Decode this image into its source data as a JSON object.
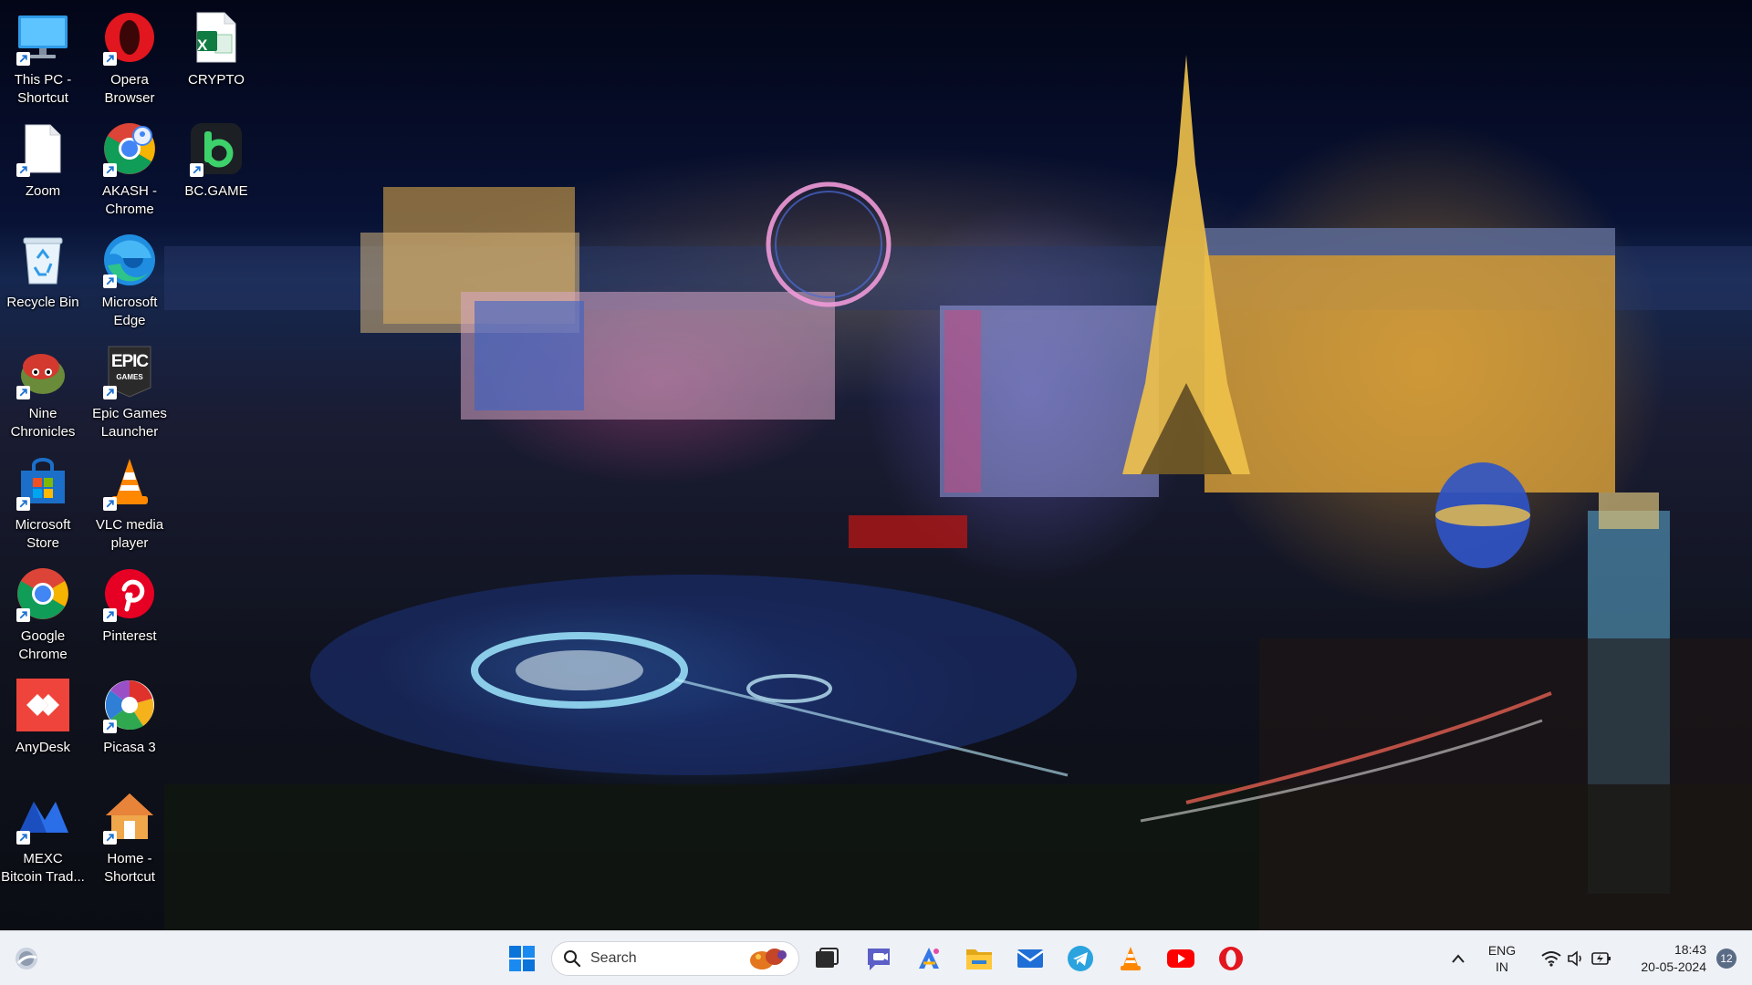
{
  "desktop": {
    "icons": [
      {
        "label": "This PC - Shortcut"
      },
      {
        "label": "Opera Browser"
      },
      {
        "label": "CRYPTO"
      },
      {
        "label": "Zoom"
      },
      {
        "label": "AKASH - Chrome"
      },
      {
        "label": "BC.GAME"
      },
      {
        "label": "Recycle Bin"
      },
      {
        "label": "Microsoft Edge"
      },
      {
        "label": "Nine Chronicles"
      },
      {
        "label": "Epic Games Launcher"
      },
      {
        "label": "Microsoft Store"
      },
      {
        "label": "VLC media player"
      },
      {
        "label": "Google Chrome"
      },
      {
        "label": "Pinterest"
      },
      {
        "label": "AnyDesk"
      },
      {
        "label": "Picasa 3"
      },
      {
        "label": "MEXC Bitcoin Trad..."
      },
      {
        "label": "Home - Shortcut"
      }
    ],
    "epic_logo_text": "EPIC",
    "epic_logo_sub": "GAMES",
    "excel_logo_text": "X"
  },
  "taskbar": {
    "search_placeholder": "Search",
    "language": "ENG",
    "region": "IN",
    "time": "18:43",
    "date": "20-05-2024",
    "notification_count": "12",
    "pinned": [
      "Start",
      "Search",
      "Task View",
      "Teams Chat",
      "Copilot",
      "File Explorer",
      "Mail",
      "Telegram",
      "VLC media player",
      "YouTube",
      "Opera"
    ]
  },
  "colors": {
    "taskbar_bg": "#eef1f6",
    "accent": "#0067c0",
    "opera_red": "#e1161e",
    "excel_green": "#107c41",
    "pinterest_red": "#e60023",
    "anydesk_red": "#ef443b",
    "youtube_red": "#ff0000",
    "telegram_blue": "#2aa3df"
  }
}
